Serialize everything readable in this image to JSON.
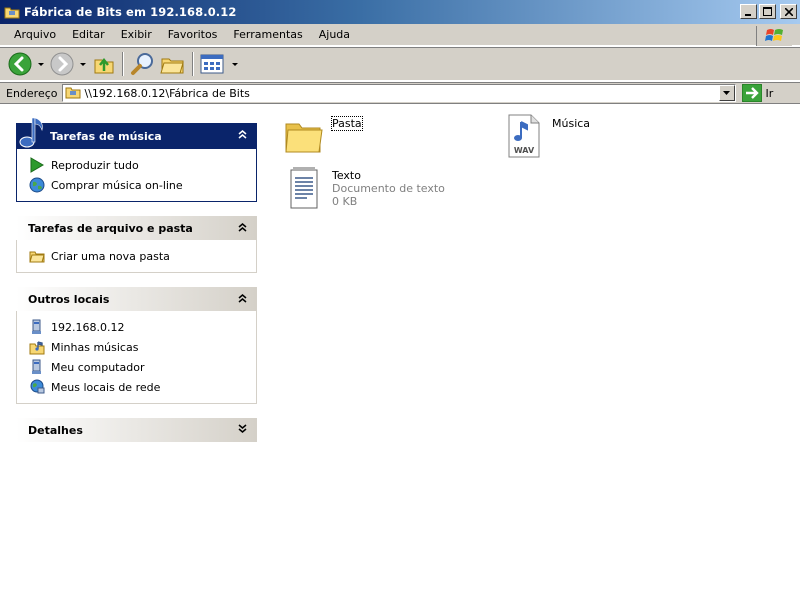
{
  "window": {
    "title": "Fábrica de Bits em 192.168.0.12"
  },
  "menu": [
    "Arquivo",
    "Editar",
    "Exibir",
    "Favoritos",
    "Ferramentas",
    "Ajuda"
  ],
  "address": {
    "label": "Endereço",
    "value": "\\\\192.168.0.12\\Fábrica de Bits",
    "go_label": "Ir"
  },
  "taskpane": {
    "music": {
      "title": "Tarefas de música",
      "items": [
        {
          "label": "Reproduzir tudo",
          "icon": "play-icon"
        },
        {
          "label": "Comprar música on-line",
          "icon": "globe-icon"
        }
      ]
    },
    "file_folder": {
      "title": "Tarefas de arquivo e pasta",
      "items": [
        {
          "label": "Criar uma nova pasta",
          "icon": "new-folder-icon"
        }
      ]
    },
    "other_places": {
      "title": "Outros locais",
      "items": [
        {
          "label": "192.168.0.12",
          "icon": "network-computer-icon"
        },
        {
          "label": "Minhas músicas",
          "icon": "music-folder-icon"
        },
        {
          "label": "Meu computador",
          "icon": "computer-icon"
        },
        {
          "label": "Meus locais de rede",
          "icon": "network-places-icon"
        }
      ]
    },
    "details": {
      "title": "Detalhes"
    }
  },
  "files": [
    {
      "name": "Pasta",
      "type": "folder"
    },
    {
      "name": "Música",
      "type": "wav",
      "badge": "WAV"
    },
    {
      "name": "Texto",
      "type": "text",
      "subtype": "Documento de texto",
      "size": "0 KB"
    }
  ],
  "colors": {
    "titlebar": "#0a246a",
    "face": "#d4d0c8",
    "special_header": "#0a246a"
  }
}
